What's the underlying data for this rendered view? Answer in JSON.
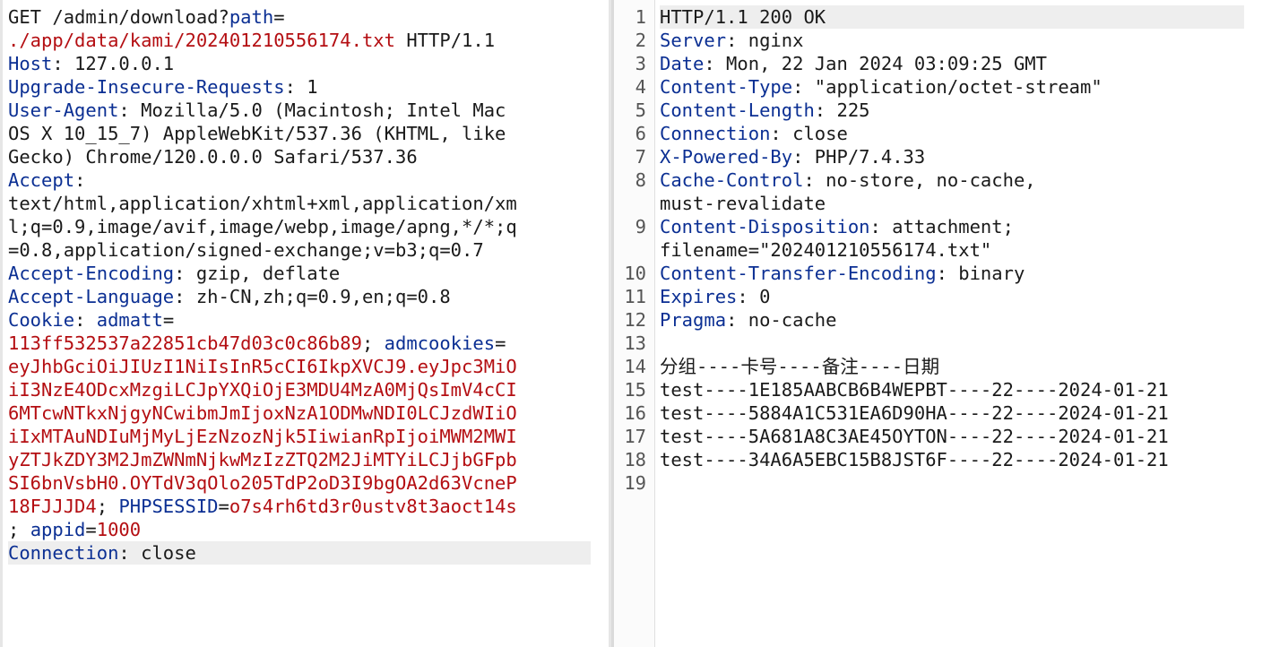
{
  "request": {
    "lines": [
      [
        {
          "t": "GET /admin/download?",
          "c": "v"
        },
        {
          "t": "path",
          "c": "k"
        },
        {
          "t": "=",
          "c": "v"
        }
      ],
      [
        {
          "t": "./app/data/kami/202401210556174.txt",
          "c": "r"
        },
        {
          "t": " HTTP/1.1",
          "c": "v"
        }
      ],
      [
        {
          "t": "Host",
          "c": "k"
        },
        {
          "t": ": 127.0.0.1",
          "c": "v"
        }
      ],
      [
        {
          "t": "Upgrade-Insecure-Requests",
          "c": "k"
        },
        {
          "t": ": 1",
          "c": "v"
        }
      ],
      [
        {
          "t": "User-Agent",
          "c": "k"
        },
        {
          "t": ": Mozilla/5.0 (Macintosh; Intel Mac",
          "c": "v"
        }
      ],
      [
        {
          "t": "OS X 10_15_7) AppleWebKit/537.36 (KHTML, like",
          "c": "v"
        }
      ],
      [
        {
          "t": "Gecko) Chrome/120.0.0.0 Safari/537.36",
          "c": "v"
        }
      ],
      [
        {
          "t": "Accept",
          "c": "k"
        },
        {
          "t": ":",
          "c": "v"
        }
      ],
      [
        {
          "t": "text/html,application/xhtml+xml,application/xm",
          "c": "v"
        }
      ],
      [
        {
          "t": "l;q=0.9,image/avif,image/webp,image/apng,*/*;q",
          "c": "v"
        }
      ],
      [
        {
          "t": "=0.8,application/signed-exchange;v=b3;q=0.7",
          "c": "v"
        }
      ],
      [
        {
          "t": "Accept-Encoding",
          "c": "k"
        },
        {
          "t": ": gzip, deflate",
          "c": "v"
        }
      ],
      [
        {
          "t": "Accept-Language",
          "c": "k"
        },
        {
          "t": ": zh-CN,zh;q=0.9,en;q=0.8",
          "c": "v"
        }
      ],
      [
        {
          "t": "Cookie",
          "c": "k"
        },
        {
          "t": ": ",
          "c": "v"
        },
        {
          "t": "admatt",
          "c": "k"
        },
        {
          "t": "=",
          "c": "v"
        }
      ],
      [
        {
          "t": "113ff532537a22851cb47d03c0c86b89",
          "c": "r"
        },
        {
          "t": "; ",
          "c": "v"
        },
        {
          "t": "admcookies",
          "c": "k"
        },
        {
          "t": "=",
          "c": "v"
        }
      ],
      [
        {
          "t": "eyJhbGciOiJIUzI1NiIsInR5cCI6IkpXVCJ9.eyJpc3MiO",
          "c": "r"
        }
      ],
      [
        {
          "t": "iI3NzE4ODcxMzgiLCJpYXQiOjE3MDU4MzA0MjQsImV4cCI",
          "c": "r"
        }
      ],
      [
        {
          "t": "6MTcwNTkxNjgyNCwibmJmIjoxNzA1ODMwNDI0LCJzdWIiO",
          "c": "r"
        }
      ],
      [
        {
          "t": "iIxMTAuNDIuMjMyLjEzNzozNjk5IiwianRpIjoiMWM2MWI",
          "c": "r"
        }
      ],
      [
        {
          "t": "yZTJkZDY3M2JmZWNmNjkwMzIzZTQ2M2JiMTYiLCJjbGFpb",
          "c": "r"
        }
      ],
      [
        {
          "t": "SI6bnVsbH0.OYTdV3qOlo205TdP2oD3I9bgOA2d63VcneP",
          "c": "r"
        }
      ],
      [
        {
          "t": "18FJJJD4",
          "c": "r"
        },
        {
          "t": "; ",
          "c": "v"
        },
        {
          "t": "PHPSESSID",
          "c": "k"
        },
        {
          "t": "=",
          "c": "v"
        },
        {
          "t": "o7s4rh6td3r0ustv8t3aoct14s",
          "c": "r"
        }
      ],
      [
        {
          "t": "; ",
          "c": "v"
        },
        {
          "t": "appid",
          "c": "k"
        },
        {
          "t": "=",
          "c": "v"
        },
        {
          "t": "1000",
          "c": "r"
        }
      ],
      [
        {
          "t": "Connection",
          "c": "k"
        },
        {
          "t": ": close",
          "c": "v"
        }
      ]
    ],
    "highlight_index": 23
  },
  "response": {
    "lines": [
      {
        "n": "1",
        "segs": [
          {
            "t": "HTTP/1.1 200 OK",
            "c": "v"
          }
        ]
      },
      {
        "n": "2",
        "segs": [
          {
            "t": "Server",
            "c": "k"
          },
          {
            "t": ": nginx",
            "c": "v"
          }
        ]
      },
      {
        "n": "3",
        "segs": [
          {
            "t": "Date",
            "c": "k"
          },
          {
            "t": ": Mon, 22 Jan 2024 03:09:25 GMT",
            "c": "v"
          }
        ]
      },
      {
        "n": "4",
        "segs": [
          {
            "t": "Content-Type",
            "c": "k"
          },
          {
            "t": ": \"application/octet-stream\"",
            "c": "v"
          }
        ]
      },
      {
        "n": "5",
        "segs": [
          {
            "t": "Content-Length",
            "c": "k"
          },
          {
            "t": ": 225",
            "c": "v"
          }
        ]
      },
      {
        "n": "6",
        "segs": [
          {
            "t": "Connection",
            "c": "k"
          },
          {
            "t": ": close",
            "c": "v"
          }
        ]
      },
      {
        "n": "7",
        "segs": [
          {
            "t": "X-Powered-By",
            "c": "k"
          },
          {
            "t": ": PHP/7.4.33",
            "c": "v"
          }
        ]
      },
      {
        "n": "8",
        "segs": [
          {
            "t": "Cache-Control",
            "c": "k"
          },
          {
            "t": ": no-store, no-cache,",
            "c": "v"
          }
        ]
      },
      {
        "n": "",
        "segs": [
          {
            "t": "must-revalidate",
            "c": "v"
          }
        ]
      },
      {
        "n": "9",
        "segs": [
          {
            "t": "Content-Disposition",
            "c": "k"
          },
          {
            "t": ": attachment;",
            "c": "v"
          }
        ]
      },
      {
        "n": "",
        "segs": [
          {
            "t": "filename=\"202401210556174.txt\"",
            "c": "v"
          }
        ]
      },
      {
        "n": "10",
        "segs": [
          {
            "t": "Content-Transfer-Encoding",
            "c": "k"
          },
          {
            "t": ": binary",
            "c": "v"
          }
        ]
      },
      {
        "n": "11",
        "segs": [
          {
            "t": "Expires",
            "c": "k"
          },
          {
            "t": ": 0",
            "c": "v"
          }
        ]
      },
      {
        "n": "12",
        "segs": [
          {
            "t": "Pragma",
            "c": "k"
          },
          {
            "t": ": no-cache",
            "c": "v"
          }
        ]
      },
      {
        "n": "13",
        "segs": []
      },
      {
        "n": "14",
        "segs": [
          {
            "t": "分组----卡号----备注----日期",
            "c": "v"
          }
        ]
      },
      {
        "n": "15",
        "segs": [
          {
            "t": "test----1E185AABCB6B4WEPBT----22----2024-01-21",
            "c": "v"
          }
        ]
      },
      {
        "n": "16",
        "segs": [
          {
            "t": "test----5884A1C531EA6D90HA----22----2024-01-21",
            "c": "v"
          }
        ]
      },
      {
        "n": "17",
        "segs": [
          {
            "t": "test----5A681A8C3AE45OYTON----22----2024-01-21",
            "c": "v"
          }
        ]
      },
      {
        "n": "18",
        "segs": [
          {
            "t": "test----34A6A5EBC15B8JST6F----22----2024-01-21",
            "c": "v"
          }
        ]
      },
      {
        "n": "19",
        "segs": []
      }
    ],
    "highlight_index": 0
  }
}
